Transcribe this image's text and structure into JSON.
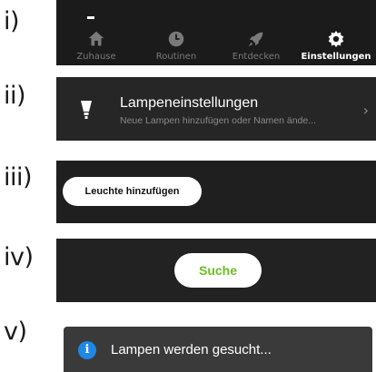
{
  "labels": {
    "i": "i)",
    "ii": "ii)",
    "iii": "iii)",
    "iv": "iv)",
    "v": "v)"
  },
  "nav": {
    "items": [
      {
        "label": "Zuhause",
        "icon": "home-icon",
        "active": false
      },
      {
        "label": "Routinen",
        "icon": "clock-icon",
        "active": false
      },
      {
        "label": "Entdecken",
        "icon": "rocket-icon",
        "active": false
      },
      {
        "label": "Einstellungen",
        "icon": "gear-icon",
        "active": true
      }
    ]
  },
  "settings_row": {
    "title": "Lampeneinstellungen",
    "subtitle": "Neue Lampen hinzufügen oder Namen ände...",
    "icon": "lamp-icon"
  },
  "add_light": {
    "label": "Leuchte hinzufügen"
  },
  "search": {
    "label": "Suche",
    "color": "#6bbf1f"
  },
  "toast": {
    "text": "Lampen werden gesucht...",
    "icon": "info-icon",
    "icon_color": "#1e88e5"
  }
}
